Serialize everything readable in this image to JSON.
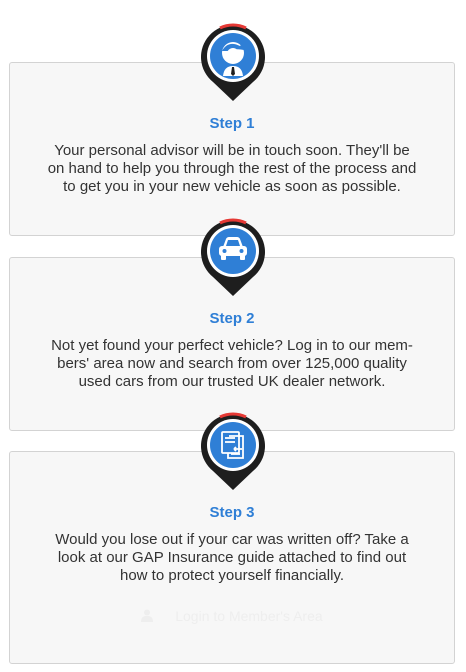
{
  "steps": [
    {
      "title": "Step 1",
      "icon": "advisor-icon",
      "text": "Your personal advisor will be in touch soon. They'll be on hand to help you through the rest of the process and to get you in your new vehicle as soon as possible."
    },
    {
      "title": "Step 2",
      "icon": "car-icon",
      "text": "Not yet found your perfect vehicle? Log in to our mem-bers' area now and search from over 125,000 quality used cars from our trusted UK dealer network."
    },
    {
      "title": "Step 3",
      "icon": "document-icon",
      "text": "Would you lose out if your car was written off? Take a look at our GAP Insurance guide attached to find out how to protect yourself financially."
    }
  ],
  "login_button": {
    "label": "Login to Member's Area",
    "icon": "user-icon"
  },
  "colors": {
    "accent": "#2f7fd6",
    "pin_dark": "#1e1e1e",
    "pin_red": "#e53935",
    "card_bg": "#f7f7f7"
  }
}
